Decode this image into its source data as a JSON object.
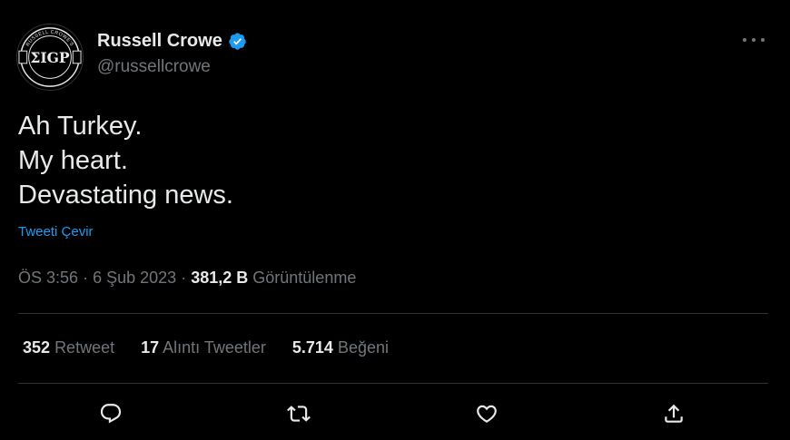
{
  "author": {
    "display_name": "Russell Crowe",
    "handle": "@russellcrowe",
    "avatar_text": "ΣIGP",
    "avatar_ring_text_top": "RUSSELL CROWE'S",
    "verified_icon": "verified-badge-icon"
  },
  "tweet": {
    "lines": [
      "Ah Turkey.",
      "My heart.",
      "Devastating news."
    ],
    "translate_label": "Tweeti Çevir"
  },
  "meta": {
    "time": "ÖS 3:56",
    "separator": "·",
    "date": "6 Şub 2023",
    "views_count": "381,2 B",
    "views_label": "Görüntülenme"
  },
  "stats": {
    "retweets_count": "352",
    "retweets_label": "Retweet",
    "quotes_count": "17",
    "quotes_label": "Alıntı Tweetler",
    "likes_count": "5.714",
    "likes_label": "Beğeni"
  },
  "actions": [
    "reply-icon",
    "retweet-icon",
    "like-icon",
    "share-icon"
  ],
  "colors": {
    "background": "#000000",
    "text_primary": "#e7e9ea",
    "text_secondary": "#71767b",
    "accent": "#1d9bf0",
    "divider": "#2f3336"
  }
}
